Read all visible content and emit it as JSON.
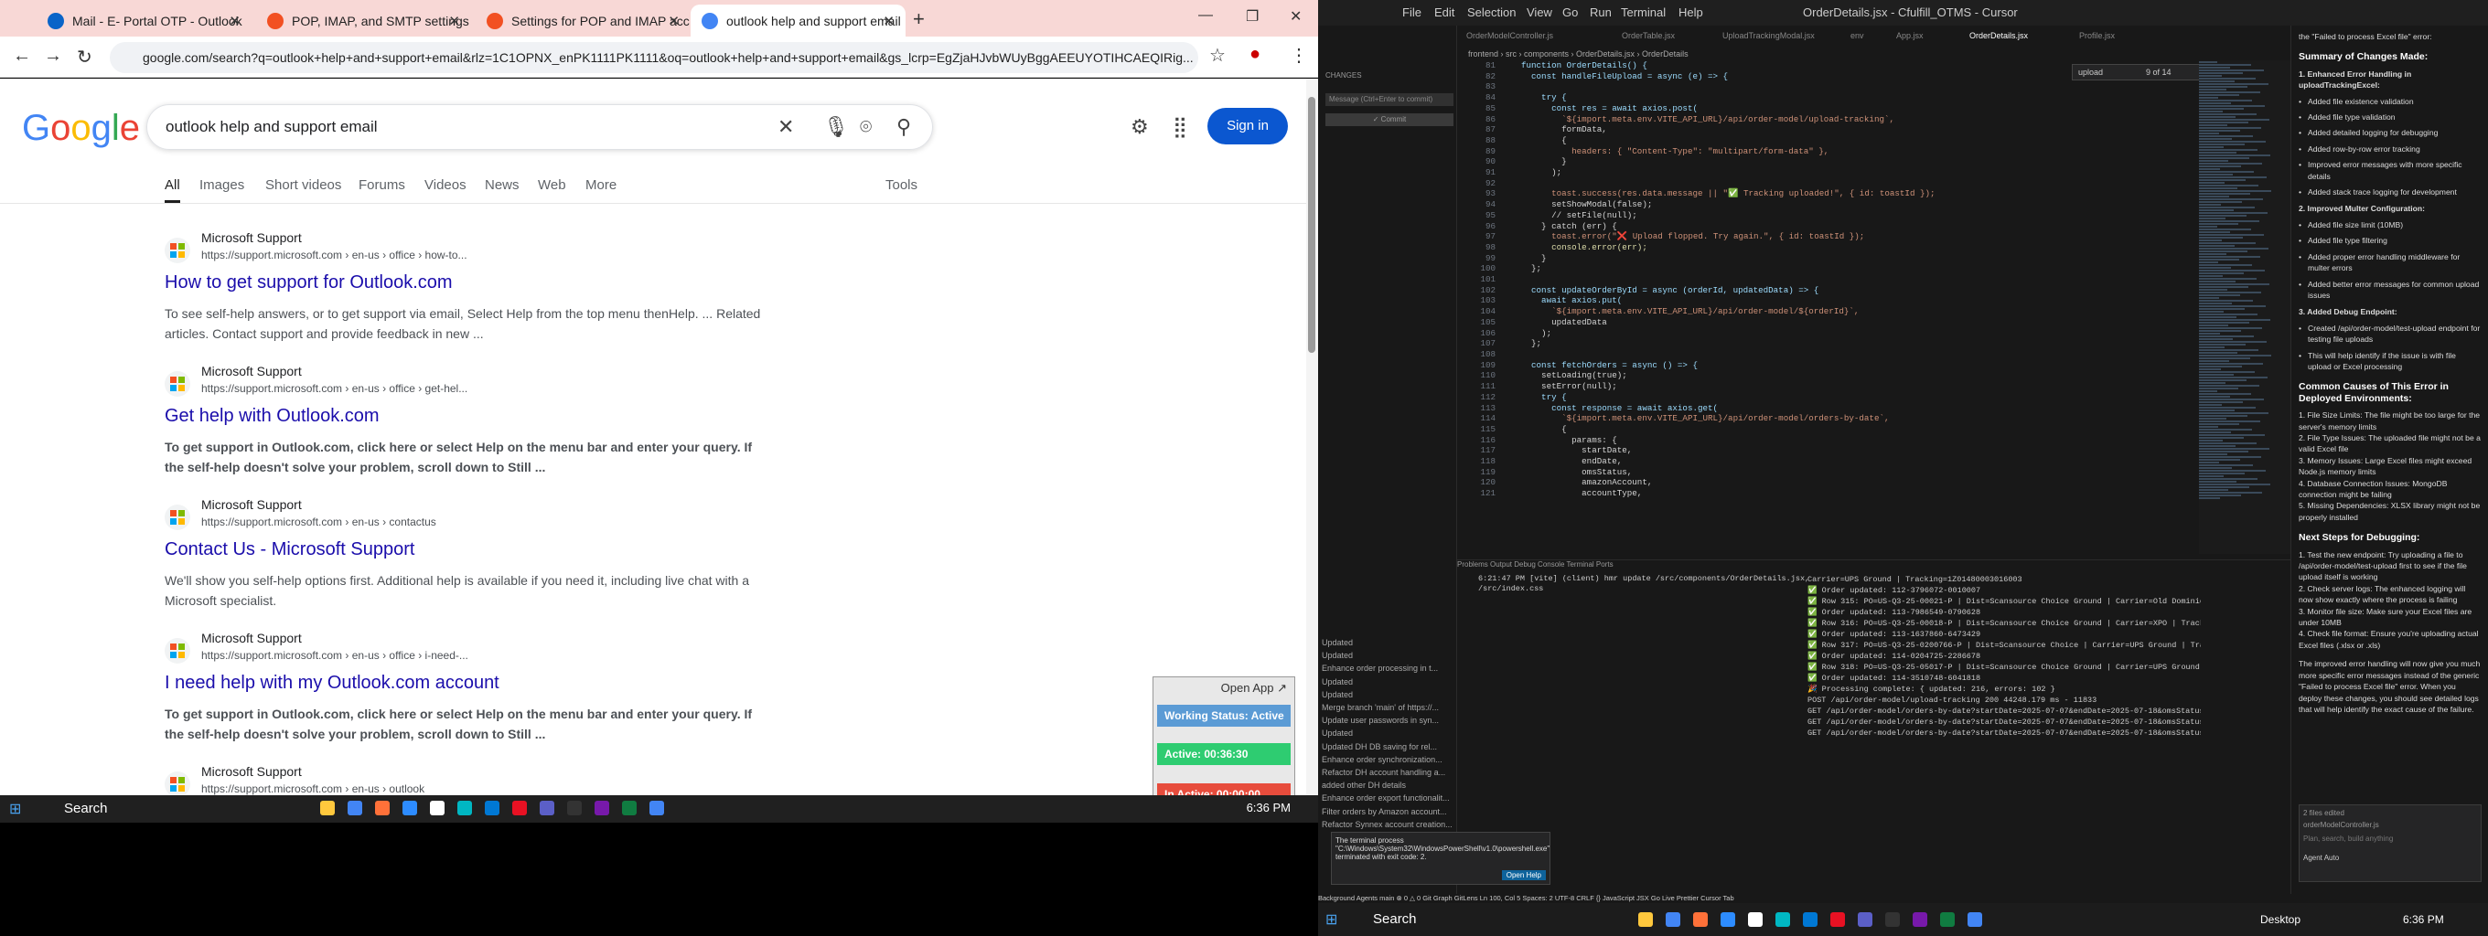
{
  "browser": {
    "tabs": [
      {
        "label": "Mail - E- Portal OTP - Outlook",
        "icon": "outlook-icon",
        "color": "#0a64c8"
      },
      {
        "label": "POP, IMAP, and SMTP settings f",
        "icon": "microsoft-icon",
        "color": "#f25022"
      },
      {
        "label": "Settings for POP and IMAP acc",
        "icon": "microsoft-icon",
        "color": "#f25022"
      },
      {
        "label": "outlook help and support email",
        "icon": "google-icon",
        "color": "#4285f4"
      }
    ],
    "url": "google.com/search?q=outlook+help+and+support+email&rlz=1C1OPNX_enPK1111PK1111&oq=outlook+help+and+support+email&gs_lcrp=EgZjaHJvbWUyBggAEEUYOTIHCAEQIRig..."
  },
  "google": {
    "logo": "Google",
    "query": "outlook help and support email",
    "signin": "Sign in",
    "tabs": [
      "All",
      "Images",
      "Short videos",
      "Forums",
      "Videos",
      "News",
      "Web",
      "More"
    ],
    "tools": "Tools",
    "results": [
      {
        "site": "Microsoft Support",
        "url": "https://support.microsoft.com › en-us › office › how-to...",
        "title": "How to get support for Outlook.com",
        "snippet": "To see self-help answers, or to get support via email, Select Help from the top menu thenHelp. ... Related articles. Contact support and provide feedback in new ..."
      },
      {
        "site": "Microsoft Support",
        "url": "https://support.microsoft.com › en-us › office › get-hel...",
        "title": "Get help with Outlook.com",
        "snippet": "To get support in Outlook.com, click here or select Help on the menu bar and enter your query. If the self-help doesn't solve your problem, scroll down to Still ..."
      },
      {
        "site": "Microsoft Support",
        "url": "https://support.microsoft.com › en-us › contactus",
        "title": "Contact Us - Microsoft Support",
        "snippet": "We'll show you self-help options first. Additional help is available if you need it, including live chat with a Microsoft specialist."
      },
      {
        "site": "Microsoft Support",
        "url": "https://support.microsoft.com › en-us › office › i-need-...",
        "title": "I need help with my Outlook.com account",
        "snippet": "To get support in Outlook.com, click here or select Help on the menu bar and enter your query. If the self-help doesn't solve your problem, scroll down to Still ..."
      },
      {
        "site": "Microsoft Support",
        "url": "https://support.microsoft.com › en-us › outlook",
        "title": "",
        "snippet": ""
      }
    ]
  },
  "widget": {
    "open": "Open App ↗",
    "working": "Working Status: Active",
    "active": "Active: 00:36:30",
    "inactive": "In Active: 00:00:00"
  },
  "taskbar": {
    "search": "Search",
    "time": "6:36 PM",
    "desktop": "Desktop"
  },
  "ide": {
    "menus": [
      "File",
      "Edit",
      "Selection",
      "View",
      "Go",
      "Run",
      "Terminal",
      "Help"
    ],
    "title": "OrderDetails.jsx - Cfulfill_OTMS - Cursor",
    "tabs": [
      "OrderModelController.js",
      "OrderTable.jsx",
      "UploadTrackingModal.jsx",
      "env",
      "App.jsx",
      "OrderDetails.jsx",
      "Profile.jsx"
    ],
    "breadcrumb": "frontend › src › components › OrderDetails.jsx › OrderDetails",
    "changes": "CHANGES",
    "commit_placeholder": "Message (Ctrl+Enter to commit)",
    "commit_btn": "✓ Commit",
    "find": "upload",
    "find_count": "9 of 14",
    "line_start": 81,
    "code": [
      "function OrderDetails() {",
      "  const handleFileUpload = async (e) => {",
      "",
      "    try {",
      "      const res = await axios.post(",
      "        `${import.meta.env.VITE_API_URL}/api/order-model/upload-tracking`,",
      "        formData,",
      "        {",
      "          headers: { \"Content-Type\": \"multipart/form-data\" },",
      "        }",
      "      );",
      "",
      "      toast.success(res.data.message || \"✅ Tracking uploaded!\", { id: toastId });",
      "      setShowModal(false);",
      "      // setFile(null);",
      "    } catch (err) {",
      "      toast.error(\"❌ Upload flopped. Try again.\", { id: toastId });",
      "      console.error(err);",
      "    }",
      "  };",
      "",
      "  const updateOrderById = async (orderId, updatedData) => {",
      "    await axios.put(",
      "      `${import.meta.env.VITE_API_URL}/api/order-model/${orderId}`,",
      "      updatedData",
      "    );",
      "  };",
      "",
      "  const fetchOrders = async () => {",
      "    setLoading(true);",
      "    setError(null);",
      "    try {",
      "      const response = await axios.get(",
      "        `${import.meta.env.VITE_API_URL}/api/order-model/orders-by-date`,",
      "        {",
      "          params: {",
      "            startDate,",
      "            endDate,",
      "            omsStatus,",
      "            amazonAccount,",
      "            accountType,"
    ],
    "panel_tabs": "Problems   Output   Debug Console   Terminal   Ports",
    "term_left": "6:21:47 PM [vite] (client) hmr update /src/components/OrderDetails.jsx, /src/index.css",
    "term_right": "Carrier=UPS Ground | Tracking=1Z01480003016003\n✅ Order updated: 112-3796072-0010007\n✅ Row 315: PO=US-Q3-25-00021-P | Dist=Scansource Choice Ground | Carrier=Old Dominion | Tracking=6245863375\n✅ Order updated: 113-7986549-0790628\n✅ Row 316: PO=US-Q3-25-00018-P | Dist=Scansource Choice Ground | Carrier=XPO | Tracking=977704302\n✅ Order updated: 113-1637860-6473429\n✅ Row 317: PO=US-Q3-25-0200766-P | Dist=Scansource Choice | Carrier=UPS Ground | Tracking=1Z7925580369762769\n✅ Order updated: 114-0204725-2286678\n✅ Row 318: PO=US-Q3-25-05017-P | Dist=Scansource Choice Ground | Carrier=UPS Ground | Tracking=1Z79255a0369792834\n✅ Order updated: 114-3510748-6041818\n🎉 Processing complete: { updated: 216, errors: 102 }\nPOST /api/order-model/upload-tracking 200 44248.179 ms - 11833\nGET /api/order-model/orders-by-date?startDate=2025-07-07&endDate=2025-07-18&omsStatus=&amazonAccount=&accountType=&distributor=&poNumber=&orderNumber=&page=1&limit=20 200 14130.030 ms - 10172\nGET /api/order-model/orders-by-date?startDate=2025-07-07&endDate=2025-07-18&omsStatus=&amazonAccount=&accountType=&distributor=&poNumber=US-Q3-25-00516-P&orderNumber=&page=1&limit=20 200 73.571 ms - 73\nGET /api/order-model/orders-by-date?startDate=2025-07-07&endDate=2025-07-18&omsStatus=&amazonAccount=&accountType=&distributor=&poNumber=US-Q3-25-00504-P&orderNumber=&page=1&limit=20 200 145.678 ms - 6",
    "toast": "The terminal process \"C:\\Windows\\System32\\WindowsPowerShell\\v1.0\\powershell.exe\" terminated with exit code: 2.",
    "toast_btn": "Open Help",
    "graph": [
      "Updated",
      "Updated",
      "Enhance order processing in t...",
      "Updated",
      "Updated",
      "Merge branch 'main' of https://...",
      "Update user passwords in syn...",
      "Updated",
      "Updated DH DB saving for rel...",
      "Enhance order synchronization...",
      "Refactor DH account handling a...",
      "added other DH details",
      "Enhance order export functionalit...",
      "Filter orders by Amazon account...",
      "Refactor Synnex account creation..."
    ],
    "chat": {
      "intro": "the \"Failed to process Excel file\" error:",
      "h1": "Summary of Changes Made:",
      "s1": "1. Enhanced Error Handling in uploadTrackingExcel:",
      "l1": [
        "Added file existence validation",
        "Added file type validation",
        "Added detailed logging for debugging",
        "Added row-by-row error tracking",
        "Improved error messages with more specific details",
        "Added stack trace logging for development"
      ],
      "s2": "2. Improved Multer Configuration:",
      "l2": [
        "Added file size limit (10MB)",
        "Added file type filtering",
        "Added proper error handling middleware for multer errors",
        "Added better error messages for common upload issues"
      ],
      "s3": "3. Added Debug Endpoint:",
      "l3": [
        "Created /api/order-model/test-upload endpoint for testing file uploads",
        "This will help identify if the issue is with file upload or Excel processing"
      ],
      "h2": "Common Causes of This Error in Deployed Environments:",
      "l4": [
        "1. File Size Limits: The file might be too large for the server's memory limits",
        "2. File Type Issues: The uploaded file might not be a valid Excel file",
        "3. Memory Issues: Large Excel files might exceed Node.js memory limits",
        "4. Database Connection Issues: MongoDB connection might be failing",
        "5. Missing Dependencies: XLSX library might not be properly installed"
      ],
      "h3": "Next Steps for Debugging:",
      "l5": [
        "1. Test the new endpoint: Try uploading a file to /api/order-model/test-upload first to see if the file upload itself is working",
        "2. Check server logs: The enhanced logging will now show exactly where the process is failing",
        "3. Monitor file size: Make sure your Excel files are under 10MB",
        "4. Check file format: Ensure you're uploading actual Excel files (.xlsx or .xls)"
      ],
      "outro": "The improved error handling will now give you much more specific error messages instead of the generic \"Failed to process Excel file\" error. When you deploy these changes, you should see detailed logs that will help identify the exact cause of the failure.",
      "input": "Plan, search, build anything",
      "files": "2 files edited",
      "file1": "orderModelController.js",
      "agent": "Agent  Auto"
    },
    "status": "Background Agents   main   ⊗ 0 △ 0   Git Graph   GitLens   Ln 100, Col 5   Spaces: 2   UTF-8   CRLF   {} JavaScript JSX   Go Live   Prettier   Cursor Tab"
  },
  "colors": {
    "working": "#5b9bd5",
    "active": "#2ecc71",
    "inactive": "#e74c3c",
    "accent": "#0b57d0"
  }
}
